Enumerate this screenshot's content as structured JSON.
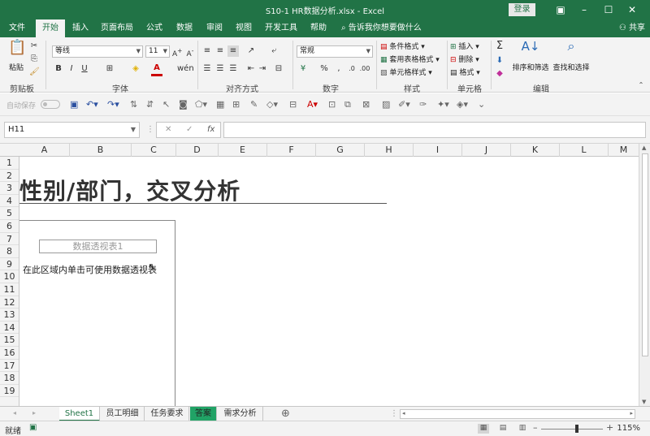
{
  "window": {
    "title": "S10-1 HR数据分析.xlsx  -  Excel",
    "login_label": "登录"
  },
  "ribbon_tabs": [
    {
      "label": "文件"
    },
    {
      "label": "开始"
    },
    {
      "label": "插入"
    },
    {
      "label": "页面布局"
    },
    {
      "label": "公式"
    },
    {
      "label": "数据"
    },
    {
      "label": "审阅"
    },
    {
      "label": "视图"
    },
    {
      "label": "开发工具"
    },
    {
      "label": "帮助"
    }
  ],
  "tell_me": "告诉我你想要做什么",
  "share": "共享",
  "ribbon": {
    "clipboard": {
      "paste": "粘贴",
      "group": "剪贴板"
    },
    "font": {
      "name": "等线",
      "size": "11",
      "group": "字体",
      "bold": "B",
      "italic": "I",
      "underline": "U"
    },
    "alignment": {
      "group": "对齐方式"
    },
    "number": {
      "format": "常规",
      "group": "数字"
    },
    "styles": {
      "conditional": "条件格式",
      "table": "套用表格格式",
      "cell": "单元格样式",
      "group": "样式"
    },
    "cells": {
      "insert": "插入",
      "delete": "删除",
      "format": "格式",
      "group": "单元格"
    },
    "editing": {
      "sort": "排序和筛选",
      "find": "查找和选择",
      "group": "编辑"
    }
  },
  "qat": {
    "autosave": "自动保存"
  },
  "formula_bar": {
    "name_box": "H11",
    "fx": "fx",
    "formula": ""
  },
  "columns": [
    "A",
    "B",
    "C",
    "D",
    "E",
    "F",
    "G",
    "H",
    "I",
    "J",
    "K",
    "L",
    "M"
  ],
  "rows": [
    "1",
    "2",
    "3",
    "4",
    "5",
    "6",
    "7",
    "8",
    "9",
    "10",
    "11",
    "12",
    "13",
    "14",
    "15",
    "16",
    "17",
    "18",
    "19"
  ],
  "sheet": {
    "big_title": "性别/部门，交叉分析",
    "pivot_name": "数据透视表1",
    "pivot_hint": "在此区域内单击可使用数据透视表"
  },
  "sheet_tabs": [
    {
      "label": "Sheet1"
    },
    {
      "label": "员工明细"
    },
    {
      "label": "任务要求"
    },
    {
      "label": "答案"
    },
    {
      "label": "需求分析"
    }
  ],
  "status": {
    "ready": "就绪",
    "zoom": "115%"
  }
}
